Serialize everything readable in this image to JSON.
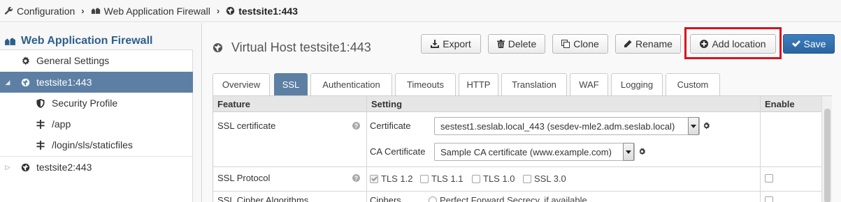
{
  "breadcrumb": {
    "items": [
      "Configuration",
      "Web Application Firewall",
      "testsite1:443"
    ]
  },
  "sidebar": {
    "title": "Web Application Firewall",
    "items": [
      {
        "label": "General Settings",
        "icon": "gear-icon"
      },
      {
        "label": "testsite1:443",
        "icon": "globe-icon",
        "selected": true,
        "expanded": true
      },
      {
        "label": "Security Profile",
        "icon": "shield-icon"
      },
      {
        "label": "/app",
        "icon": "location-icon"
      },
      {
        "label": "/login/sls/staticfiles",
        "icon": "location-icon"
      },
      {
        "label": "testsite2:443",
        "icon": "globe-icon",
        "expanded": false
      }
    ]
  },
  "main": {
    "title": "Virtual Host testsite1:443",
    "buttons": {
      "export": "Export",
      "delete": "Delete",
      "clone": "Clone",
      "rename": "Rename",
      "add_location": "Add location",
      "save": "Save"
    },
    "tabs": [
      "Overview",
      "SSL",
      "Authentication",
      "Timeouts",
      "HTTP",
      "Translation",
      "WAF",
      "Logging",
      "Custom"
    ],
    "active_tab": "SSL",
    "table": {
      "headers": {
        "feature": "Feature",
        "setting": "Setting",
        "enable": "Enable"
      },
      "rows": {
        "ssl_certificate": {
          "feature": "SSL certificate",
          "certificate_label": "Certificate",
          "certificate_value": "sestest1.seslab.local_443 (sesdev-mle2.adm.seslab.local)",
          "ca_label": "CA Certificate",
          "ca_value": "Sample CA certificate (www.example.com)"
        },
        "ssl_protocol": {
          "feature": "SSL Protocol",
          "protocols": [
            {
              "label": "TLS 1.2",
              "checked": true
            },
            {
              "label": "TLS 1.1",
              "checked": false
            },
            {
              "label": "TLS 1.0",
              "checked": false
            },
            {
              "label": "SSL 3.0",
              "checked": false
            }
          ]
        },
        "ssl_cipher": {
          "feature": "SSL Cipher Algorithms",
          "ciphers_label": "Ciphers",
          "option_label": "Perfect Forward Secrecy, if available"
        }
      }
    }
  },
  "colors": {
    "accent": "#5d7fa4",
    "primary_button": "#2a64a0",
    "highlight": "#d8121e"
  }
}
